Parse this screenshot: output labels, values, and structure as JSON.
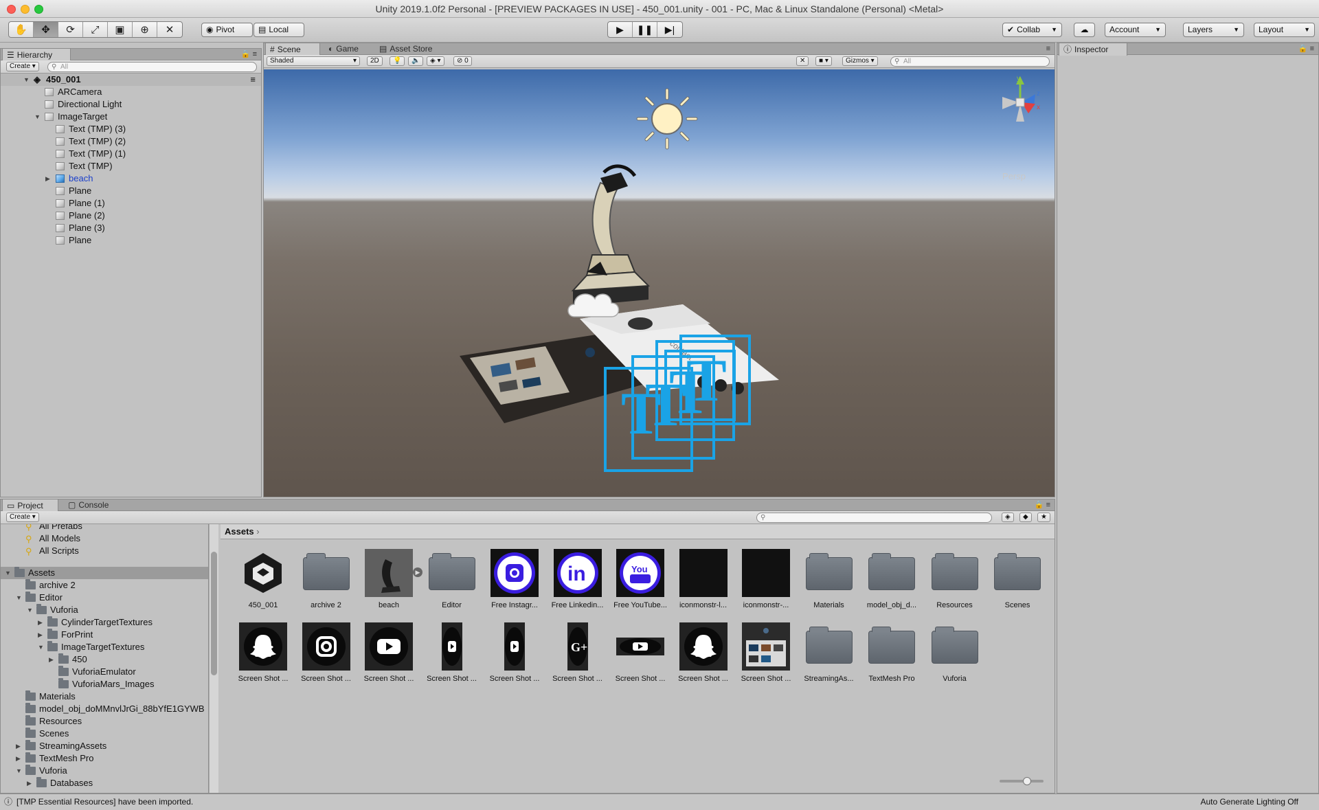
{
  "window": {
    "title": "Unity 2019.1.0f2 Personal - [PREVIEW PACKAGES IN USE] - 450_001.unity - 001 - PC, Mac & Linux Standalone (Personal) <Metal>"
  },
  "toolbar": {
    "tools": [
      "hand-icon",
      "move-icon",
      "rotate-icon",
      "scale-icon",
      "rect-icon",
      "transform-icon",
      "custom-tool-icon"
    ],
    "pivot_label": "Pivot",
    "local_label": "Local",
    "collab_label": "Collab",
    "account_label": "Account",
    "layers_label": "Layers",
    "layout_label": "Layout"
  },
  "hierarchy": {
    "tab": "Hierarchy",
    "create_label": "Create",
    "search_placeholder": "All",
    "scene_name": "450_001",
    "items": [
      "ARCamera",
      "Directional Light",
      "ImageTarget",
      "Text (TMP) (3)",
      "Text (TMP) (2)",
      "Text (TMP) (1)",
      "Text (TMP)",
      "beach",
      "Plane",
      "Plane (1)",
      "Plane (2)",
      "Plane (3)",
      "Plane"
    ]
  },
  "scene": {
    "tabs": [
      "Scene",
      "Game",
      "Asset Store"
    ],
    "shading": "Shaded",
    "mode_2d": "2D",
    "fx_count": "0",
    "gizmos_label": "Gizmos",
    "search_placeholder": "All",
    "projection_label": "Persp",
    "gizmo_axes": [
      "y",
      "z",
      "x"
    ]
  },
  "inspector": {
    "tab": "Inspector"
  },
  "project": {
    "tabs": [
      "Project",
      "Console"
    ],
    "create_label": "Create",
    "breadcrumb": "Assets",
    "tree": [
      "All Prefabs",
      "All Models",
      "All Scripts",
      "Assets",
      "archive 2",
      "Editor",
      "Vuforia",
      "CylinderTargetTextures",
      "ForPrint",
      "ImageTargetTextures",
      "450",
      "VuforiaEmulator",
      "VuforiaMars_Images",
      "Materials",
      "model_obj_doMMnvlJrGi_88bYfE1GYWB",
      "Resources",
      "Scenes",
      "StreamingAssets",
      "TextMesh Pro",
      "Vuforia",
      "Databases"
    ],
    "assets_row1": [
      {
        "label": "450_001",
        "kind": "unity"
      },
      {
        "label": "archive 2",
        "kind": "folder"
      },
      {
        "label": "beach",
        "kind": "model"
      },
      {
        "label": "Editor",
        "kind": "folder"
      },
      {
        "label": "Free Instagr...",
        "kind": "instagram"
      },
      {
        "label": "Free Linkedin...",
        "kind": "linkedin"
      },
      {
        "label": "Free YouTube...",
        "kind": "youtube"
      },
      {
        "label": "iconmonstr-l...",
        "kind": "black"
      },
      {
        "label": "iconmonstr-...",
        "kind": "black"
      },
      {
        "label": "Materials",
        "kind": "folder"
      },
      {
        "label": "model_obj_d...",
        "kind": "folder"
      },
      {
        "label": "Resources",
        "kind": "folder"
      },
      {
        "label": "Scenes",
        "kind": "folder"
      }
    ],
    "assets_row2": [
      {
        "label": "Screen Shot ...",
        "kind": "snapchat"
      },
      {
        "label": "Screen Shot ...",
        "kind": "insta-dark"
      },
      {
        "label": "Screen Shot ...",
        "kind": "yt-dark"
      },
      {
        "label": "Screen Shot ...",
        "kind": "yt-narrow"
      },
      {
        "label": "Screen Shot ...",
        "kind": "yt-narrow"
      },
      {
        "label": "Screen Shot ...",
        "kind": "gplus"
      },
      {
        "label": "Screen Shot ...",
        "kind": "yt-wide"
      },
      {
        "label": "Screen Shot ...",
        "kind": "snapchat"
      },
      {
        "label": "Screen Shot ...",
        "kind": "photo"
      },
      {
        "label": "StreamingAs...",
        "kind": "folder"
      },
      {
        "label": "TextMesh Pro",
        "kind": "folder"
      },
      {
        "label": "Vuforia",
        "kind": "folder"
      }
    ]
  },
  "status": {
    "message": "[TMP Essential Resources] have been imported.",
    "right": "Auto Generate Lighting Off"
  },
  "colors": {
    "selection_blue": "#1a3fcb",
    "tmp_gizmo": "#1aa3e6"
  }
}
